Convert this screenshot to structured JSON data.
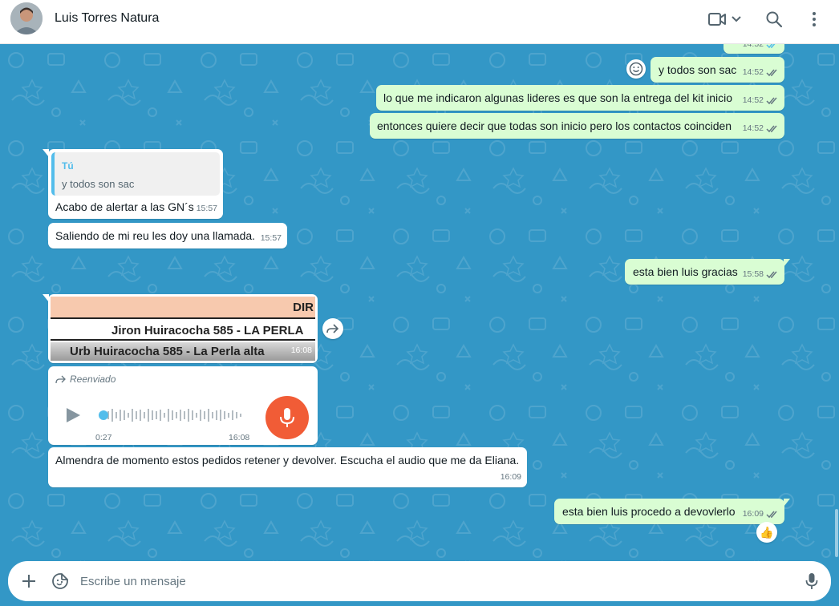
{
  "header": {
    "contact_name": "Luis Torres Natura",
    "icons": [
      "avatar",
      "video-call-icon",
      "chevron-down-icon",
      "search-icon",
      "menu-icon"
    ]
  },
  "colors": {
    "chat_background": "#3397c6",
    "outgoing_bubble": "#d9fdd3",
    "incoming_bubble": "#ffffff",
    "read_ticks": "#53bdeb",
    "mic_button": "#f15c36"
  },
  "messages": {
    "m0": {
      "text": "",
      "time": "14:52"
    },
    "m1": {
      "text": "y todos son sac",
      "time": "14:52"
    },
    "m2": {
      "text": "lo que me indicaron algunas lideres es que son la entrega del kit inicio",
      "time": "14:52"
    },
    "m3": {
      "text": "entonces quiere decir que todas son inicio pero los contactos coinciden",
      "time": "14:52"
    },
    "m4": {
      "quote_author": "Tú",
      "quote_text": "y todos son sac",
      "text": "Acabo de alertar a las GN´s",
      "time": "15:57"
    },
    "m5": {
      "text": "Saliendo de mi reu les doy una llamada.",
      "time": "15:57"
    },
    "m6": {
      "text": "esta bien luis gracias",
      "time": "15:58"
    },
    "m7": {
      "row1": "DIR",
      "row2": "Jiron Huiracocha 585 - LA PERLA",
      "row3": "Urb Huiracocha 585 - La Perla alta",
      "time": "16:08"
    },
    "m8": {
      "forwarded_label": "Reenviado",
      "duration": "0:27",
      "time": "16:08"
    },
    "m9": {
      "text": "Almendra de momento estos pedidos retener y devolver. Escucha el audio que me da Eliana.",
      "time": "16:09"
    },
    "m10": {
      "text": "esta bien luis procedo a devovlerlo",
      "time": "16:09",
      "reaction": "👍"
    }
  },
  "composer": {
    "placeholder": "Escribe un mensaje"
  }
}
